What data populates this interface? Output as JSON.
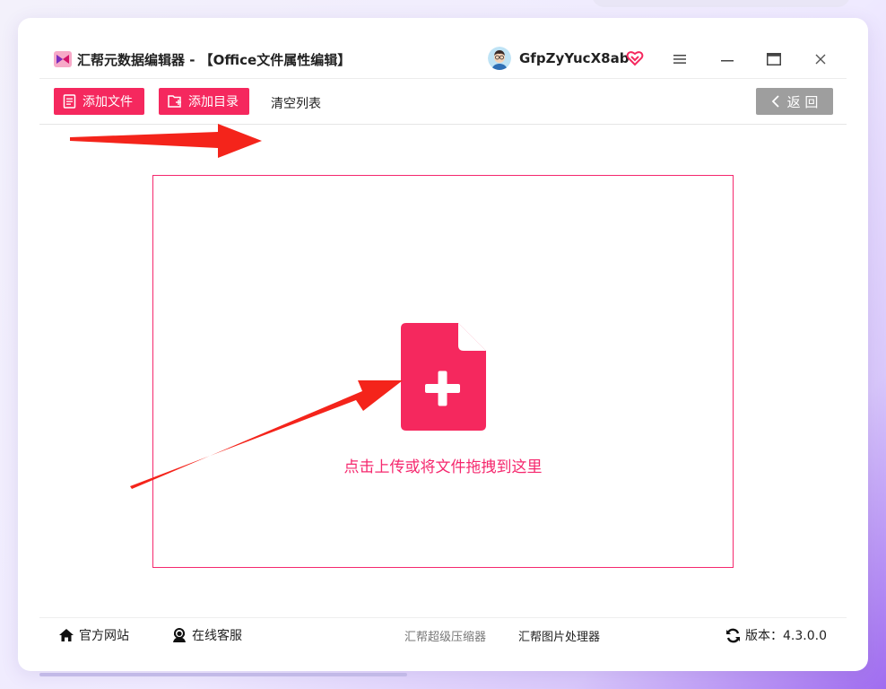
{
  "app": {
    "title": "汇帮元数据编辑器 - 【Office文件属性编辑】",
    "username": "GfpZyYucX8ab"
  },
  "toolbar": {
    "add_file_label": "添加文件",
    "add_dir_label": "添加目录",
    "clear_list_label": "清空列表",
    "back_label": "返 回"
  },
  "dropzone": {
    "hint": "点击上传或将文件拖拽到这里"
  },
  "footer": {
    "website_label": "官方网站",
    "support_label": "在线客服",
    "compressor_label": "汇帮超级压缩器",
    "image_tool_label": "汇帮图片处理器",
    "version_label": "版本：4.3.0.0"
  },
  "colors": {
    "accent": "#f5285e",
    "back_button": "#9e9e9e",
    "arrow": "#f4241b"
  },
  "icons": {
    "logo": "app-logo-icon",
    "vip": "vip-heart-icon",
    "menu": "hamburger-menu-icon",
    "minimize": "minimize-icon",
    "maximize": "maximize-icon",
    "close": "close-icon",
    "add_file": "document-list-icon",
    "add_dir": "folder-plus-icon",
    "back": "chevron-left-icon",
    "upload": "file-plus-icon",
    "home": "home-icon",
    "support": "headset-icon",
    "refresh": "refresh-icon"
  }
}
